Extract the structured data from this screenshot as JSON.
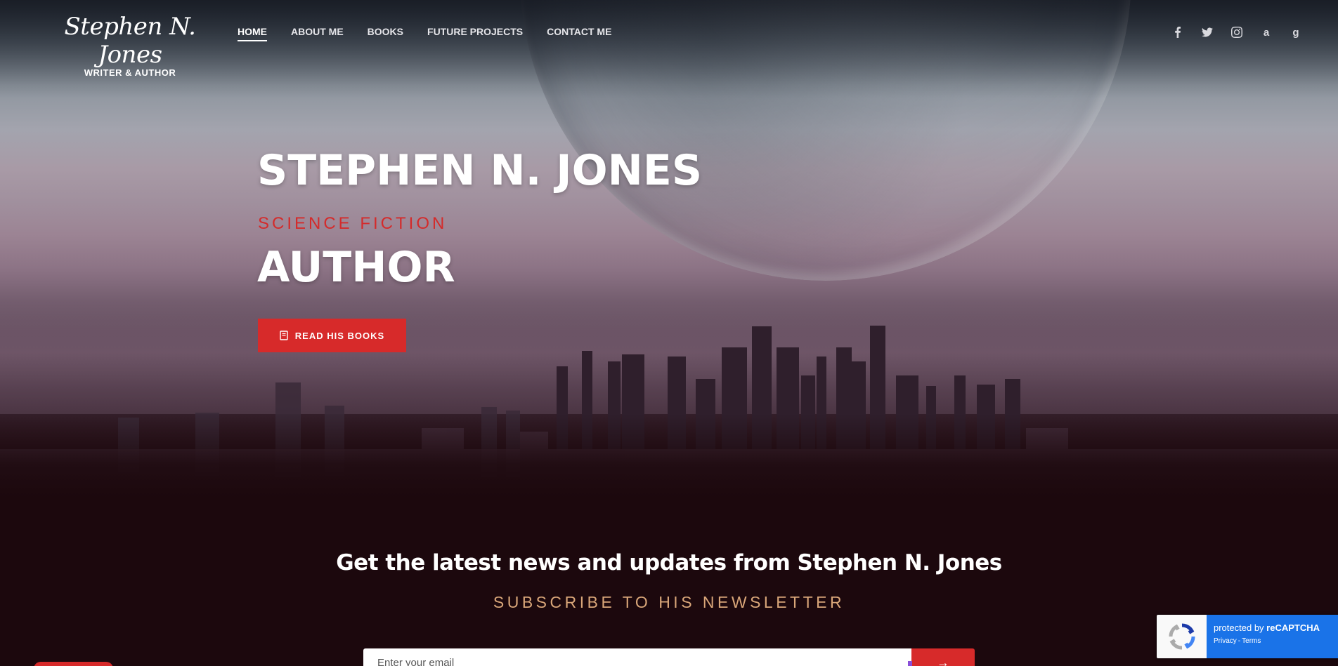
{
  "header": {
    "logo_script": "Stephen N. Jones",
    "logo_tagline": "WRITER & AUTHOR",
    "nav": [
      {
        "label": "HOME",
        "active": true
      },
      {
        "label": "ABOUT ME",
        "active": false
      },
      {
        "label": "BOOKS",
        "active": false
      },
      {
        "label": "FUTURE PROJECTS",
        "active": false
      },
      {
        "label": "CONTACT ME",
        "active": false
      }
    ],
    "social_icons": [
      "facebook-icon",
      "twitter-icon",
      "instagram-icon",
      "amazon-icon",
      "goodreads-icon"
    ]
  },
  "hero": {
    "title": "STEPHEN N. JONES",
    "subtitle": "SCIENCE FICTION",
    "role": "AUTHOR",
    "cta_label": "READ HIS BOOKS",
    "cta_icon": "book-icon"
  },
  "newsletter": {
    "title": "Get the latest news and updates from Stephen N. Jones",
    "subtitle": "SUBSCRIBE TO HIS NEWSLETTER",
    "email_placeholder": "Enter your email",
    "submit_icon": "arrow-right-icon"
  },
  "recaptcha": {
    "protected_prefix": "protected by ",
    "brand": "reCAPTCHA",
    "privacy": "Privacy",
    "separator": " - ",
    "terms": "Terms"
  },
  "colors": {
    "accent_red": "#d72a2a",
    "subtitle_gold": "#d9a679",
    "page_dark": "#1c080d",
    "recaptcha_blue": "#1a73e8"
  }
}
